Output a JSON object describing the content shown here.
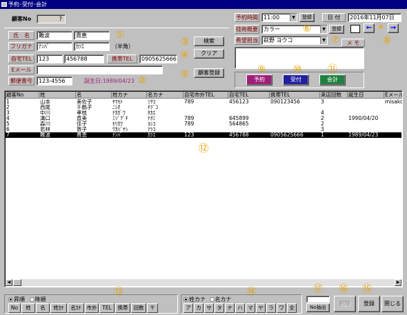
{
  "window": {
    "title": "予約･受付･会計"
  },
  "customer_no": {
    "label": "顧客No",
    "value": "?"
  },
  "name": {
    "label": "氏　名",
    "last": "難波",
    "first": "貴恵"
  },
  "furigana": {
    "label": "フリガナ",
    "last": "ﾅﾝﾊﾞ",
    "first": "ｶﾂｴ",
    "note": "（半角）"
  },
  "home_tel": {
    "label": "自宅TEL",
    "area": "123",
    "number": "456788"
  },
  "mobile_tel": {
    "label": "携帯TEL",
    "value": "0905625666"
  },
  "email": {
    "label": "Eメール",
    "value": ""
  },
  "postal": {
    "label": "郵便番号",
    "value": "123-4556",
    "birthday": "誕生日:1989/04/23"
  },
  "buttons": {
    "search": "検索",
    "clear": "クリア",
    "register_customer": "顧客登録",
    "reserve": "予約",
    "reception": "受付",
    "checkout": "会計",
    "delete": "削除",
    "save": "登録",
    "close": "閉じる",
    "no_extract": "No抽出",
    "reg_time": "登録",
    "reg_tech": "登録"
  },
  "reservation": {
    "time_label": "予約時間",
    "time_value": "11:00",
    "tech_label": "技術概要",
    "tech_value": "カラー",
    "staff_label": "希望担当",
    "staff_value": "萩野 ヨウコ",
    "date_label": "日 付",
    "date_value": "2016年11月07日",
    "memo_label": "メ モ",
    "memo_value": ""
  },
  "circle_nums": [
    "①",
    "②",
    "③",
    "④",
    "⑤",
    "⑥",
    "⑦",
    "⑧",
    "⑨",
    "⑩",
    "⑪",
    "⑫",
    "⑬",
    "⑭",
    "⑮",
    "⑯",
    "⑰"
  ],
  "nav": {
    "prev": "←",
    "sun": "☀",
    "next": "→"
  },
  "table": {
    "columns": [
      "顧客No",
      "姓",
      "名",
      "姓カナ",
      "名カナ",
      "自宅市外TEL",
      "自宅TEL",
      "携帯TEL",
      "来店回数",
      "誕生日",
      "Eメール"
    ],
    "rows": [
      [
        "1",
        "山本",
        "美佐子",
        "ﾔﾏﾓﾄ",
        "ﾐｻｺ",
        "789",
        "456123",
        "090123456",
        "3",
        "",
        "misako@"
      ],
      [
        "2",
        "西尾",
        "千鶴子",
        "ﾆｼｵ",
        "ﾁﾂﾞｺ",
        "",
        "",
        "",
        "",
        "",
        ""
      ],
      [
        "3",
        "中川",
        "孝枝",
        "ﾅｶｶﾞﾜ",
        "ﾀｶｴ",
        "",
        "",
        "",
        "4",
        "",
        ""
      ],
      [
        "4",
        "溝口",
        "直美",
        "ﾐｿﾞｸﾞﾁ",
        "ﾅｵﾐ",
        "789",
        "645899",
        "",
        "2",
        "1990/04/20",
        ""
      ],
      [
        "5",
        "森川",
        "佳子",
        "ﾓﾘｶﾜ",
        "ﾖｼｺ",
        "789",
        "564865",
        "",
        "2",
        "",
        ""
      ],
      [
        "6",
        "若林",
        "敦子",
        "ﾜｶﾊﾞﾔｼ",
        "ｱﾂｺ",
        "",
        "",
        "",
        "3",
        "",
        ""
      ],
      [
        "7",
        "難波",
        "貴恵",
        "ﾅﾝﾊﾞ",
        "ｶﾂｴ",
        "123",
        "456788",
        "0905625666",
        "1",
        "1989/04/23",
        ""
      ]
    ],
    "selected_row": 6
  },
  "sort": {
    "asc": "昇順",
    "desc": "降順",
    "fields": [
      "No",
      "姓",
      "名",
      "姓ｶﾅ",
      "名ｶﾅ",
      "市外",
      "TEL",
      "携帯",
      "回数",
      "〒"
    ]
  },
  "kana": {
    "last": "姓カナ",
    "first": "名カナ",
    "keys": [
      "ア",
      "カ",
      "サ",
      "タ",
      "ナ",
      "ハ",
      "マ",
      "ヤ",
      "ラ",
      "ワ",
      "全"
    ]
  }
}
